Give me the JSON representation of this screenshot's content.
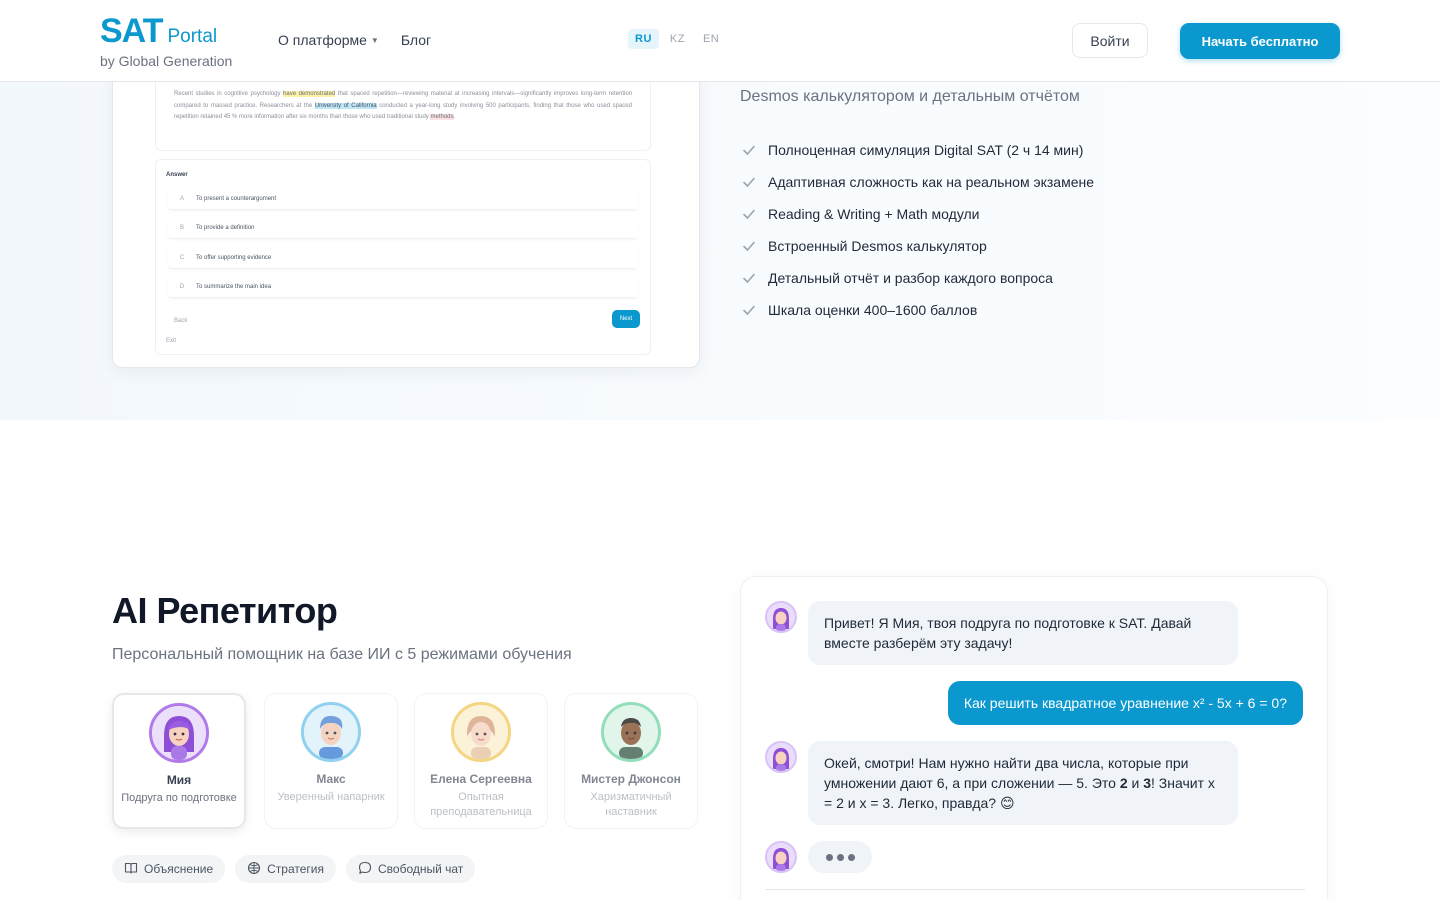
{
  "header": {
    "logo_main": "SAT",
    "logo_sub": "Portal",
    "logo_by": "by Global Generation",
    "nav": [
      {
        "label": "О платформе",
        "has_caret": true
      },
      {
        "label": "Блог",
        "has_caret": false
      }
    ],
    "languages": [
      "RU",
      "KZ",
      "EN"
    ],
    "active_language": "RU",
    "login_label": "Войти",
    "start_label": "Начать бесплатно"
  },
  "exam_preview": {
    "passage": {
      "before": "Recent studies in cognitive psychology ",
      "hl1": "have demonstrated",
      "mid1": " that spaced repetition—reviewing material at increasing intervals—significantly improves long-term retention compared to massed practice. Researchers at the ",
      "hl2": "University of California",
      "mid2": " conducted a year-long study involving 500 participants, finding that those who used spaced repetition retained 45 % more information after six months than those who used traditional study ",
      "hl3": "methods",
      "end": "."
    },
    "answer_title": "Answer",
    "options": [
      {
        "letter": "A",
        "text": "To present a counterargument"
      },
      {
        "letter": "B",
        "text": "To provide a definition"
      },
      {
        "letter": "C",
        "text": "To offer supporting evidence"
      },
      {
        "letter": "D",
        "text": "To summarize the main idea"
      }
    ],
    "back_label": "Back",
    "next_label": "Next",
    "exit_label": "Exit"
  },
  "features": {
    "subtitle": "Desmos калькулятором и детальным отчётом",
    "items": [
      "Полноценная симуляция Digital SAT (2 ч 14 мин)",
      "Адаптивная сложность как на реальном экзамене",
      "Reading & Writing + Math модули",
      "Встроенный Desmos калькулятор",
      "Детальный отчёт и разбор каждого вопроса",
      "Шкала оценки 400–1600 баллов"
    ]
  },
  "ai": {
    "title": "AI Репетитор",
    "subtitle": "Персональный помощник на базе ИИ с 5 режимами обучения",
    "tutors": [
      {
        "name": "Мия",
        "role": "Подруга по подготовке",
        "active": true,
        "color": "#b07be8"
      },
      {
        "name": "Макс",
        "role": "Уверенный напарник",
        "active": false,
        "color": "#7cc9ec"
      },
      {
        "name": "Елена Сергеевна",
        "role": "Опытная преподавательница",
        "active": false,
        "color": "#f3cf6a"
      },
      {
        "name": "Мистер Джонсон",
        "role": "Харизматичный наставник",
        "active": false,
        "color": "#7fd9b0"
      }
    ],
    "modes": [
      {
        "label": "Объяснение",
        "icon": "book-icon"
      },
      {
        "label": "Стратегия",
        "icon": "compass-icon"
      },
      {
        "label": "Свободный чат",
        "icon": "chat-bubble-icon"
      }
    ]
  },
  "chat": {
    "msg1": "Привет! Я Мия, твоя подруга по подготовке к SAT. Давай вместе разберём эту задачу!",
    "msg_user": "Как решить квадратное уравнение x² - 5x + 6 = 0?",
    "msg2_a": "Окей, смотри! Нам нужно найти два числа, которые при умножении дают 6, а при сложении — 5. Это ",
    "msg2_b1": "2",
    "msg2_and": " и ",
    "msg2_b2": "3",
    "msg2_c": "! Значит x = 2 и x = 3. Легко, правда? ",
    "msg2_emoji": "😊"
  }
}
